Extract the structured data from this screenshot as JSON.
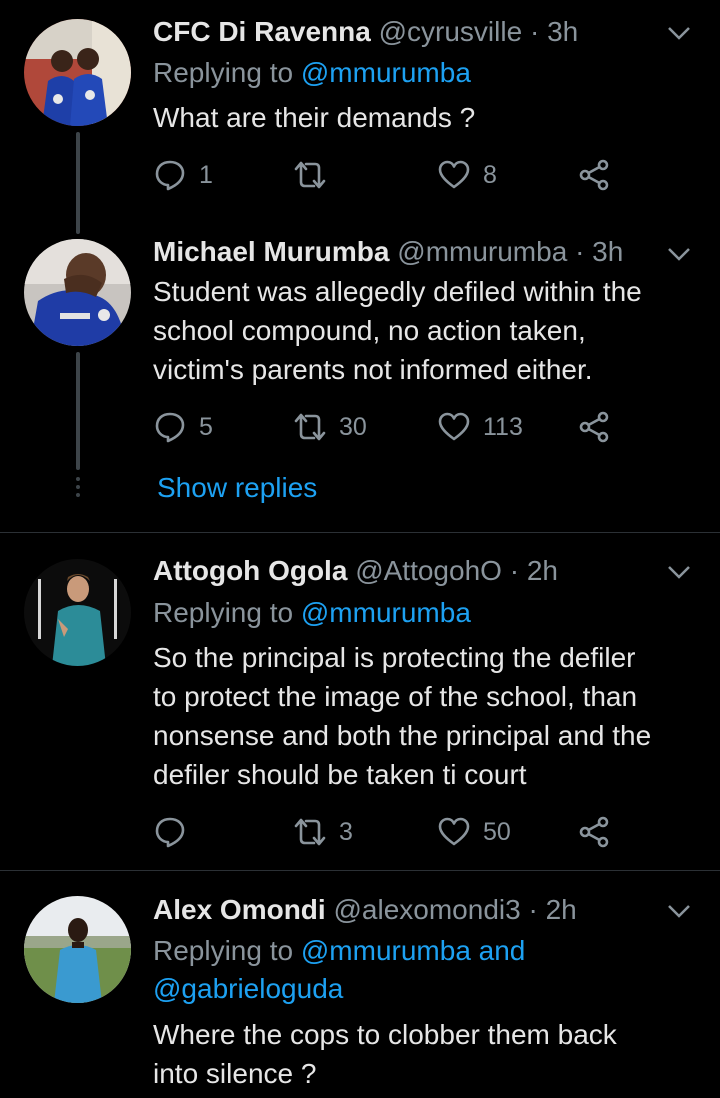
{
  "icons": {
    "reply": "reply-icon",
    "retweet": "retweet-icon",
    "like": "heart-icon",
    "share": "share-icon",
    "caret": "chevron-down-icon"
  },
  "colors": {
    "background": "#000000",
    "link": "#1da1f2",
    "muted": "#8a949c",
    "text": "#e6e6e6"
  },
  "tweets": [
    {
      "name": "CFC Di Ravenna",
      "handle": "@cyrusville",
      "sep": "·",
      "time": "3h",
      "replying_prefix": "Replying to ",
      "replying_to": "@mmurumba",
      "text": "What are their demands ?",
      "replies": "1",
      "retweets": "",
      "likes": "8"
    },
    {
      "name": "Michael Murumba",
      "handle": "@mmurumba",
      "sep": "·",
      "time": "3h",
      "text_lines": [
        "Student was allegedly defiled within the",
        "school compound, no action taken,",
        "victim's parents not informed either."
      ],
      "replies": "5",
      "retweets": "30",
      "likes": "113",
      "show_replies": "Show replies"
    },
    {
      "name": "Attogoh Ogola",
      "handle": "@AttogohO",
      "sep": "·",
      "time": "2h",
      "replying_prefix": "Replying to ",
      "replying_to": "@mmurumba",
      "text_lines": [
        "So the principal is protecting the defiler",
        "to protect the image of the school, than",
        "nonsense and both the principal and the",
        "defiler should be taken ti court"
      ],
      "replies": "",
      "retweets": "3",
      "likes": "50"
    },
    {
      "name": "Alex Omondi",
      "handle": "@alexomondi3",
      "sep": "·",
      "time": "2h",
      "replying_prefix": "Replying to ",
      "replying_to": "@mmurumba and",
      "replying_to_2": "@gabrieloguda",
      "text_lines": [
        "Where the cops to clobber them back",
        "into silence ?"
      ]
    }
  ]
}
